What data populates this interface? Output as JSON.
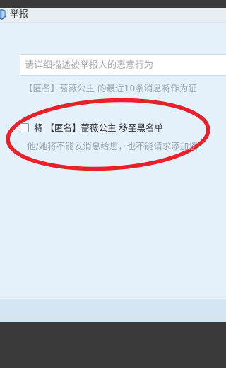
{
  "window": {
    "title": "举报",
    "icon": "shield-icon"
  },
  "report": {
    "reason_placeholder": "请详细描述被举报人的恶意行为",
    "evidence_note": "【匿名】蔷薇公主 的最近10条消息将作为证"
  },
  "blacklist": {
    "checked": false,
    "label": "将 【匿名】蔷薇公主 移至黑名单",
    "note": "他/她将不能发消息给您，也不能请求添加您"
  },
  "colors": {
    "highlight_ring": "#e8202a",
    "panel_bg": "#e4f1fa",
    "footer_bg": "#d3e5f0",
    "outer_bg": "#3a3a3a"
  }
}
